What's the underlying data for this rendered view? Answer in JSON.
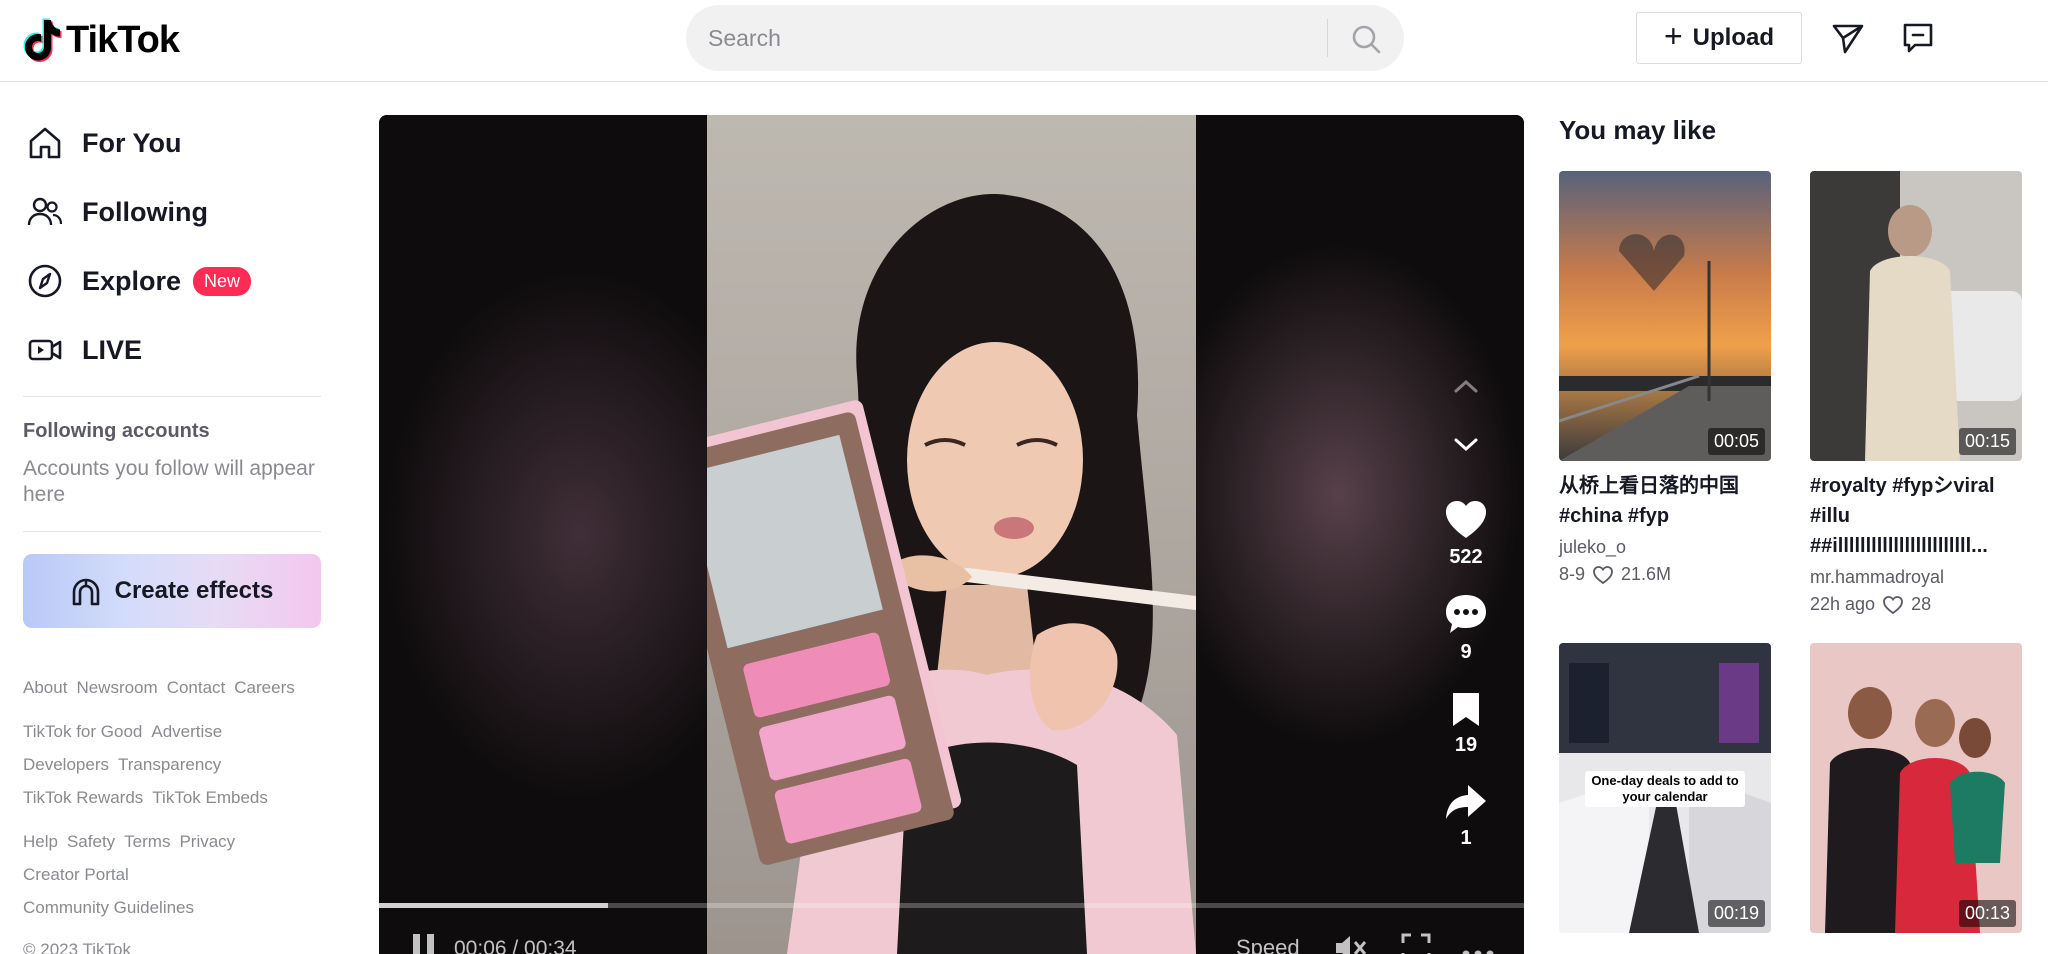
{
  "header": {
    "logo_text": "TikTok",
    "search_placeholder": "Search",
    "upload_label": "Upload"
  },
  "sidebar": {
    "nav": [
      {
        "label": "For You",
        "icon": "home-icon"
      },
      {
        "label": "Following",
        "icon": "users-icon"
      },
      {
        "label": "Explore",
        "icon": "compass-icon",
        "badge": "New"
      },
      {
        "label": "LIVE",
        "icon": "live-icon"
      }
    ],
    "following_title": "Following accounts",
    "following_desc": "Accounts you follow will appear here",
    "create_effects": "Create effects",
    "footer_rows": [
      [
        "About",
        "Newsroom",
        "Contact",
        "Careers"
      ],
      [
        "TikTok for Good",
        "Advertise"
      ],
      [
        "Developers",
        "Transparency"
      ],
      [
        "TikTok Rewards",
        "TikTok Embeds"
      ],
      [
        "Help",
        "Safety",
        "Terms",
        "Privacy"
      ],
      [
        "Creator Portal"
      ],
      [
        "Community Guidelines"
      ]
    ],
    "copyright": "© 2023 TikTok"
  },
  "player": {
    "progress": 0.2,
    "time": "00:06 / 00:34",
    "speed_label": "Speed",
    "likes": "522",
    "comments": "9",
    "bookmarks": "19",
    "shares": "1"
  },
  "recommendations": {
    "title": "You may like",
    "cards": [
      {
        "title": "从桥上看日落的中国\n#china #fyp",
        "author": "juleko_o",
        "date": "8-9",
        "likes": "21.6M",
        "duration": "00:05"
      },
      {
        "title": "#royalty #fypシviral #illu\n##illllllllllllllllllllllll...",
        "author": "mr.hammadroyal",
        "date": "22h ago",
        "likes": "28",
        "duration": "00:15"
      },
      {
        "title": "",
        "overlay": "One-day deals to add to your calendar",
        "duration": "00:19"
      },
      {
        "title": "",
        "duration": "00:13"
      }
    ]
  },
  "colors": {
    "accent": "#fe2c55",
    "text": "#161823",
    "muted": "#8a8b91"
  }
}
